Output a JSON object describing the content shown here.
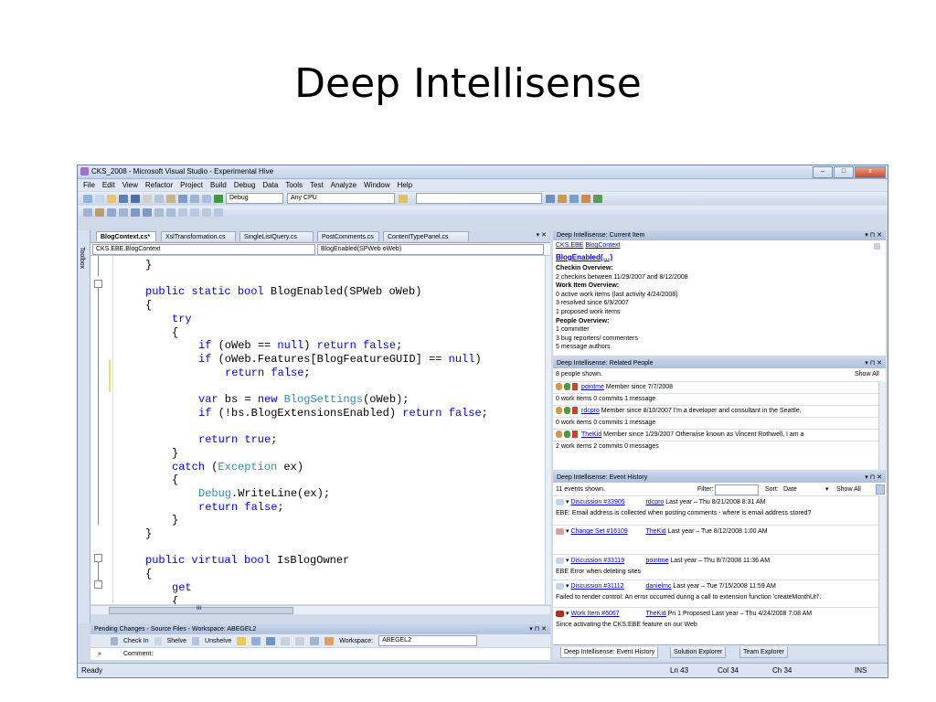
{
  "slide": {
    "title": "Deep Intellisense"
  },
  "window": {
    "title": "CKS_2008 - Microsoft Visual Studio - Experimental Hive",
    "min": "–",
    "max": "□",
    "close": "x"
  },
  "menu": [
    "File",
    "Edit",
    "View",
    "Refactor",
    "Project",
    "Build",
    "Debug",
    "Data",
    "Tools",
    "Test",
    "Analyze",
    "Window",
    "Help"
  ],
  "toolbar": {
    "config": "Debug",
    "platform": "Any CPU"
  },
  "editor": {
    "tabs": [
      "BlogContext.cs*",
      "XslTransformation.cs",
      "SingleListQuery.cs",
      "PostComments.cs",
      "ContentTypePanel.cs"
    ],
    "close": "▾ ✕",
    "nav_left": "CKS.EBE.BlogContext",
    "nav_right": "BlogEnabled(SPWeb oWeb)",
    "toolbox_label": "Toolbox",
    "hscroll_mark": "III",
    "lines": [
      {
        "indent": 4,
        "parts": [
          {
            "t": "}"
          }
        ]
      },
      {
        "indent": 0,
        "parts": []
      },
      {
        "indent": 4,
        "parts": [
          {
            "t": "public static bool",
            "c": "kw"
          },
          {
            "t": " BlogEnabled(SPWeb oWeb)"
          }
        ]
      },
      {
        "indent": 4,
        "parts": [
          {
            "t": "{"
          }
        ]
      },
      {
        "indent": 8,
        "parts": [
          {
            "t": "try",
            "c": "kw"
          }
        ]
      },
      {
        "indent": 8,
        "parts": [
          {
            "t": "{"
          }
        ]
      },
      {
        "indent": 12,
        "parts": [
          {
            "t": "if",
            "c": "kw"
          },
          {
            "t": " (oWeb == "
          },
          {
            "t": "null",
            "c": "kw"
          },
          {
            "t": ") "
          },
          {
            "t": "return false",
            "c": "kw"
          },
          {
            "t": ";"
          }
        ]
      },
      {
        "indent": 12,
        "parts": [
          {
            "t": "if",
            "c": "kw"
          },
          {
            "t": " (oWeb.Features[BlogFeatureGUID] == "
          },
          {
            "t": "null",
            "c": "kw"
          },
          {
            "t": ")"
          }
        ]
      },
      {
        "indent": 16,
        "parts": [
          {
            "t": "return false",
            "c": "kw"
          },
          {
            "t": ";"
          }
        ]
      },
      {
        "indent": 0,
        "parts": []
      },
      {
        "indent": 12,
        "parts": [
          {
            "t": "var",
            "c": "kw"
          },
          {
            "t": " bs = "
          },
          {
            "t": "new",
            "c": "kw"
          },
          {
            "t": " "
          },
          {
            "t": "BlogSettings",
            "c": "ty"
          },
          {
            "t": "(oWeb);"
          }
        ]
      },
      {
        "indent": 12,
        "parts": [
          {
            "t": "if",
            "c": "kw"
          },
          {
            "t": " (!bs.BlogExtensionsEnabled) "
          },
          {
            "t": "return false",
            "c": "kw"
          },
          {
            "t": ";"
          }
        ]
      },
      {
        "indent": 0,
        "parts": []
      },
      {
        "indent": 12,
        "parts": [
          {
            "t": "return true",
            "c": "kw"
          },
          {
            "t": ";"
          }
        ]
      },
      {
        "indent": 8,
        "parts": [
          {
            "t": "}"
          }
        ]
      },
      {
        "indent": 8,
        "parts": [
          {
            "t": "catch",
            "c": "kw"
          },
          {
            "t": " ("
          },
          {
            "t": "Exception",
            "c": "ty"
          },
          {
            "t": " ex)"
          }
        ]
      },
      {
        "indent": 8,
        "parts": [
          {
            "t": "{"
          }
        ]
      },
      {
        "indent": 12,
        "parts": [
          {
            "t": "Debug",
            "c": "ty"
          },
          {
            "t": ".WriteLine(ex);"
          }
        ]
      },
      {
        "indent": 12,
        "parts": [
          {
            "t": "return false",
            "c": "kw"
          },
          {
            "t": ";"
          }
        ]
      },
      {
        "indent": 8,
        "parts": [
          {
            "t": "}"
          }
        ]
      },
      {
        "indent": 4,
        "parts": [
          {
            "t": "}"
          }
        ]
      },
      {
        "indent": 0,
        "parts": []
      },
      {
        "indent": 4,
        "parts": [
          {
            "t": "public virtual bool",
            "c": "kw"
          },
          {
            "t": " IsBlogOwner"
          }
        ]
      },
      {
        "indent": 4,
        "parts": [
          {
            "t": "{"
          }
        ]
      },
      {
        "indent": 8,
        "parts": [
          {
            "t": "get",
            "c": "kw"
          }
        ]
      },
      {
        "indent": 8,
        "parts": [
          {
            "t": "{"
          }
        ]
      }
    ]
  },
  "pending": {
    "title": "Pending Changes - Source Files - Workspace: ABEGEL2",
    "pins": "▾ ⊓ ✕",
    "buttons": [
      "Check In",
      "Shelve",
      "Unshelve"
    ],
    "workspace_label": "Workspace:",
    "workspace": "ABEGEL2",
    "comment_label": "Comment:",
    "expander": "»"
  },
  "status": {
    "ready": "Ready",
    "ln": "Ln 43",
    "col": "Col 34",
    "ch": "Ch 34",
    "mode": "INS"
  },
  "current_item": {
    "title": "Deep Intellisense: Current Item",
    "pins": "▾ ⊓ ✕",
    "crumb1": "CKS.EBE",
    "crumb2": "BlogContext",
    "member": "BlogEnabled(…)",
    "lines": [
      {
        "t": "Checkin Overview:",
        "b": true
      },
      {
        "t": "2 checkins between 11/29/2007 and 8/12/2008"
      },
      {
        "t": "Work Item Overview:",
        "b": true
      },
      {
        "t": "0 active work items (last activity 4/24/2008)"
      },
      {
        "t": "3 resolved since 6/9/2007"
      },
      {
        "t": "1 proposed work items"
      },
      {
        "t": "People Overview:",
        "b": true
      },
      {
        "t": "1 committer"
      },
      {
        "t": "3 bug reporters/ commenters"
      },
      {
        "t": "5 message authors"
      }
    ]
  },
  "related_people": {
    "title": "Deep Intellisense: Related People",
    "pins": "▾ ⊓ ✕",
    "count": "8 people shown.",
    "show_all": "Show All",
    "people": [
      {
        "name": "pointme",
        "desc": "Member since 7/7/2008",
        "stats": "0 work items  0 commits  1 message"
      },
      {
        "name": "rdcpro",
        "desc": "Member since 8/10/2007  I'm a developer and consultant in the Seattle,",
        "stats": "0 work items  0 commits  1 message"
      },
      {
        "name": "TheKid",
        "desc": "Member since 1/29/2007  Otherwise known as Vincent Rothwell, I am a",
        "stats": "2 work items  2 commits  0 messages"
      }
    ]
  },
  "event_history": {
    "title": "Deep Intellisense: Event History",
    "pins": "▾ ⊓ ✕",
    "count": "11 events shown.",
    "filter_label": "Filter:",
    "sort_label": "Sort:",
    "sort_value": "Date",
    "show_all": "Show All",
    "events": [
      {
        "id": "Discussion #33905",
        "who": "rdcpro",
        "when": "Last year – Thu 8/21/2008 8:31 AM",
        "desc": "EBE: Email address is collected when posting comments - where is email address stored?"
      },
      {
        "id": "Change Set #16109",
        "who": "TheKid",
        "when": "Last year – Tue 8/12/2008 1:00 AM",
        "desc": ""
      },
      {
        "id": "Discussion #33119",
        "who": "pointme",
        "when": "Last year – Thu 8/7/2008 11:36 AM",
        "desc": "EBE Error when deleting sites"
      },
      {
        "id": "Discussion #31112",
        "who": "danielmc",
        "when": "Last year – Tue 7/15/2008 11:59 AM",
        "desc": "Failed to render control: An error occurred during a call to extension function 'createMonthUrl'."
      },
      {
        "id": "Work Item #6067",
        "who": "TheKid",
        "when": "Pri 1  Proposed  Last year – Thu 4/24/2008 7:08 AM",
        "desc": "Since activating the CKS:EBE feature on our Web"
      }
    ]
  },
  "bottom_tabs": [
    "Deep Intellisense: Event History",
    "Solution Explorer",
    "Team Explorer"
  ]
}
